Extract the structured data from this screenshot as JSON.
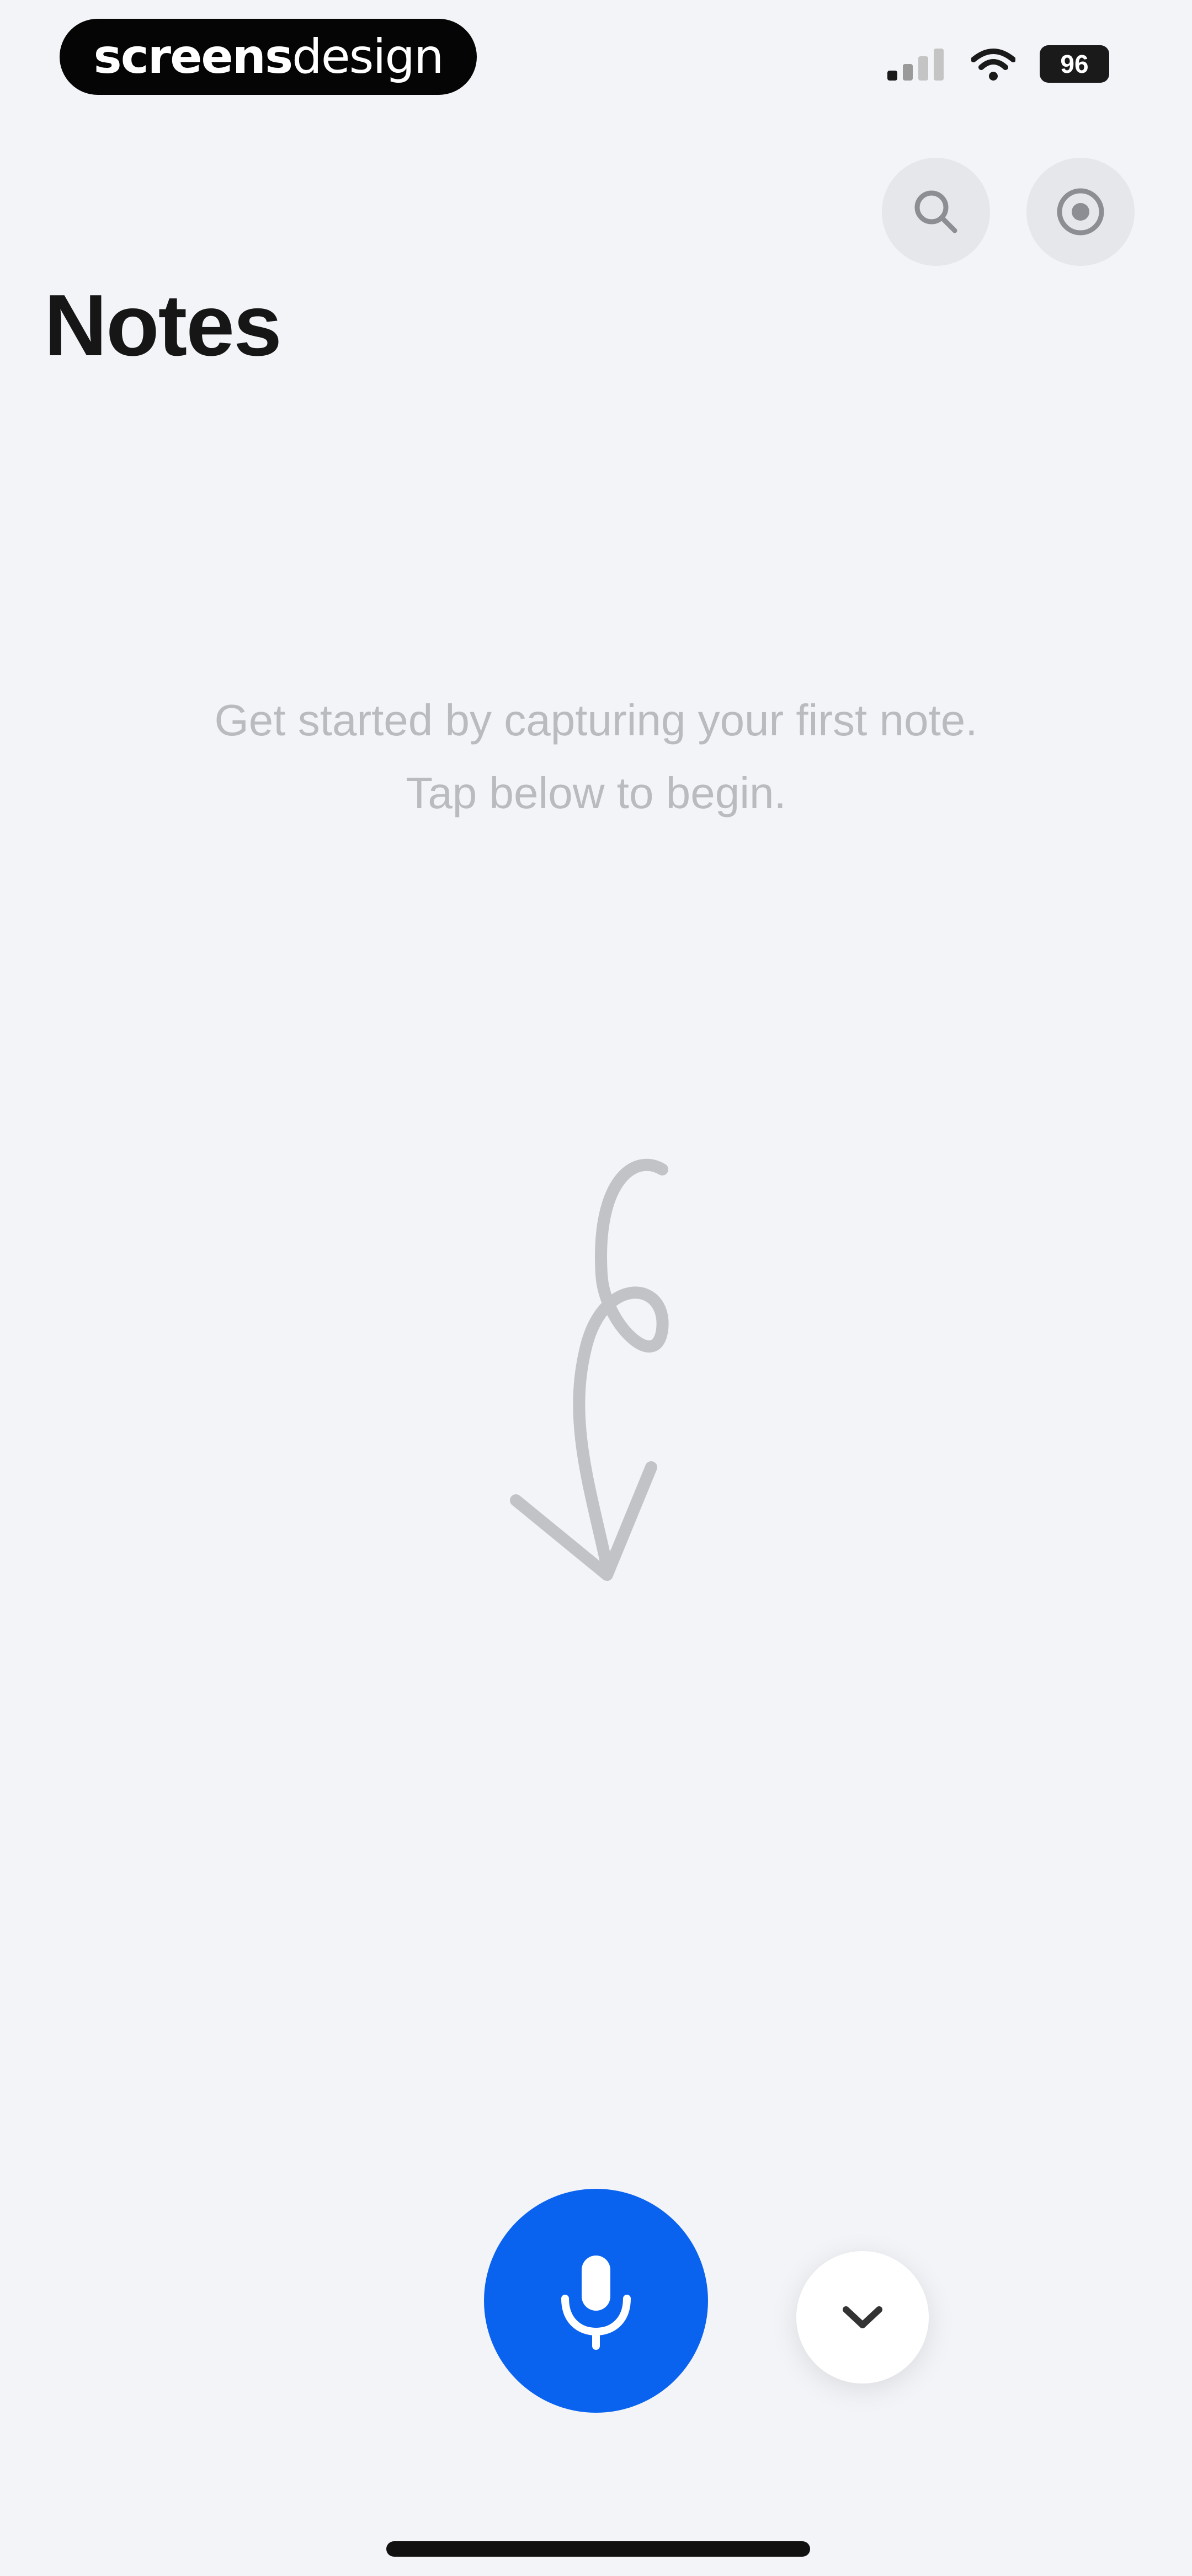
{
  "status_bar": {
    "brand": {
      "bold": "screens",
      "light": "design"
    },
    "battery_text": "96",
    "icons": [
      "signal-icon",
      "wifi-icon",
      "battery-icon"
    ]
  },
  "header": {
    "title": "Notes",
    "actions": [
      {
        "name": "search-icon"
      },
      {
        "name": "record-settings-icon"
      }
    ]
  },
  "empty_state": {
    "line1": "Get started by capturing your first note.",
    "line2": "Tap below to begin.",
    "illustration": "curly-arrow-down-icon"
  },
  "bottom_actions": {
    "primary": {
      "icon": "microphone-icon",
      "color": "#0a63ef"
    },
    "secondary": {
      "icon": "chevron-down-icon"
    }
  }
}
